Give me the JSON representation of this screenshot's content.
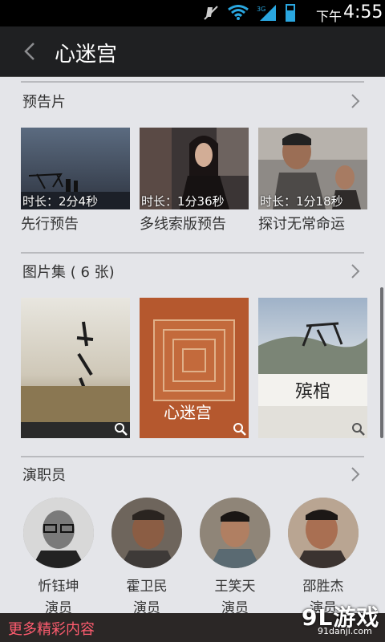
{
  "status_bar": {
    "ampm": "下午",
    "time": "4:55",
    "network": "3G",
    "icons": [
      "mute-icon",
      "wifi-icon",
      "signal-icon",
      "battery-icon"
    ]
  },
  "header": {
    "back_icon": "chevron-left-icon",
    "title": "心迷宫"
  },
  "trailers": {
    "title": "预告片",
    "items": [
      {
        "duration": "时长：2分4秒",
        "caption": "先行预告"
      },
      {
        "duration": "时长：1分36秒",
        "caption": "多线索版预告"
      },
      {
        "duration": "时长：1分18秒",
        "caption": "探讨无常命运"
      }
    ]
  },
  "gallery": {
    "title": "图片集 ( 6 张)",
    "poster2_text": "心迷宫",
    "poster3_text": "殡棺"
  },
  "cast": {
    "title": "演职员",
    "items": [
      {
        "name": "忻钰坤",
        "role": "演员"
      },
      {
        "name": "霍卫民",
        "role": "演员"
      },
      {
        "name": "王笑天",
        "role": "演员"
      },
      {
        "name": "邵胜杰",
        "role": "演员"
      }
    ]
  },
  "footer": {
    "more_link": "更多精彩内容"
  },
  "watermark": {
    "logo": "9L游戏",
    "url": "91danji.com"
  },
  "colors": {
    "status_bar_bg": "#000000",
    "title_bar_bg": "#1f2022",
    "page_bg": "#e4e5e9",
    "accent_more": "#ff5c6f",
    "battery": "#2aa7e0"
  }
}
